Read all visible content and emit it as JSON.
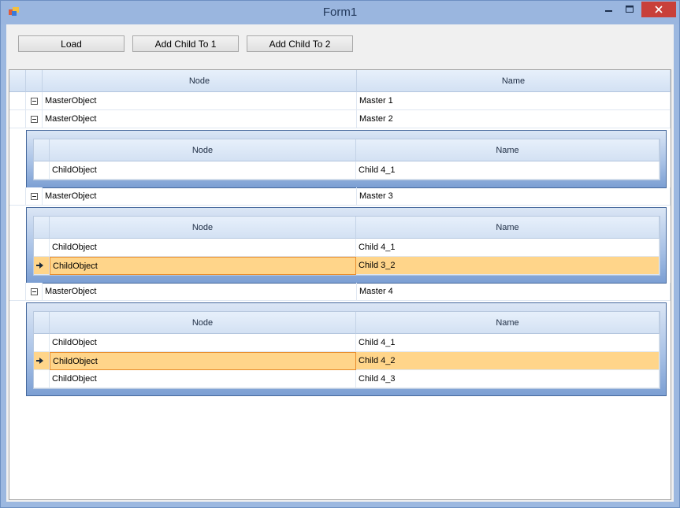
{
  "window": {
    "title": "Form1"
  },
  "toolbar": {
    "load_label": "Load",
    "add_child_1_label": "Add Child To 1",
    "add_child_2_label": "Add Child To 2"
  },
  "grid": {
    "columns": [
      "Node",
      "Name"
    ],
    "masters": [
      {
        "node": "MasterObject",
        "name": "Master 1"
      },
      {
        "node": "MasterObject",
        "name": "Master 2"
      },
      {
        "node": "MasterObject",
        "name": "Master 3"
      },
      {
        "node": "MasterObject",
        "name": "Master 4"
      }
    ],
    "child_columns": [
      "Node",
      "Name"
    ],
    "children_master2": [
      {
        "node": "ChildObject",
        "name": "Child 4_1"
      }
    ],
    "children_master3": [
      {
        "node": "ChildObject",
        "name": "Child 4_1"
      },
      {
        "node": "ChildObject",
        "name": "Child 3_2"
      }
    ],
    "children_master4": [
      {
        "node": "ChildObject",
        "name": "Child 4_1"
      },
      {
        "node": "ChildObject",
        "name": "Child 4_2"
      },
      {
        "node": "ChildObject",
        "name": "Child 4_3"
      }
    ]
  },
  "colors": {
    "selection": "#ffd58a",
    "focus_border": "#e88c2b",
    "header": "#dbe7f7",
    "titlebar": "#9ab6df",
    "close_button": "#c8403a"
  }
}
